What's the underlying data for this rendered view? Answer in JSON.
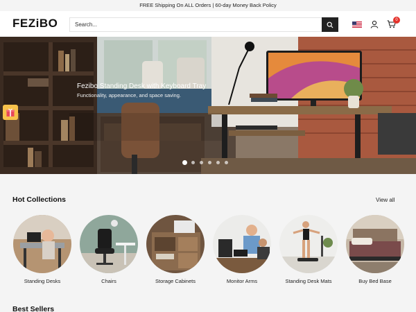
{
  "announcement": "FREE Shipping On ALL Orders | 60-day Money Back Policy",
  "header": {
    "logo": "FEZiBO",
    "search_placeholder": "Search...",
    "cart_count": "0",
    "icons": {
      "search": "search-icon",
      "flag": "us-flag-icon",
      "account": "user-icon",
      "cart": "cart-icon"
    }
  },
  "hero": {
    "title": "Fezibo Standing Desk with Keyboard Tray",
    "subtitle": "Functionality, appearance, and space saving.",
    "slides": 6,
    "active_slide": 1
  },
  "hot_collections": {
    "title": "Hot Collections",
    "view_all": "View all",
    "items": [
      {
        "label": "Standing Desks"
      },
      {
        "label": "Chairs"
      },
      {
        "label": "Storage Cabinets"
      },
      {
        "label": "Monitor Arms"
      },
      {
        "label": "Standing Desk Mats"
      },
      {
        "label": "Buy Bed Base"
      }
    ]
  },
  "best_sellers": {
    "title": "Best Sellers"
  },
  "colors": {
    "accent": "#222222",
    "badge": "#e4322b",
    "background": "#f4f4f4"
  }
}
